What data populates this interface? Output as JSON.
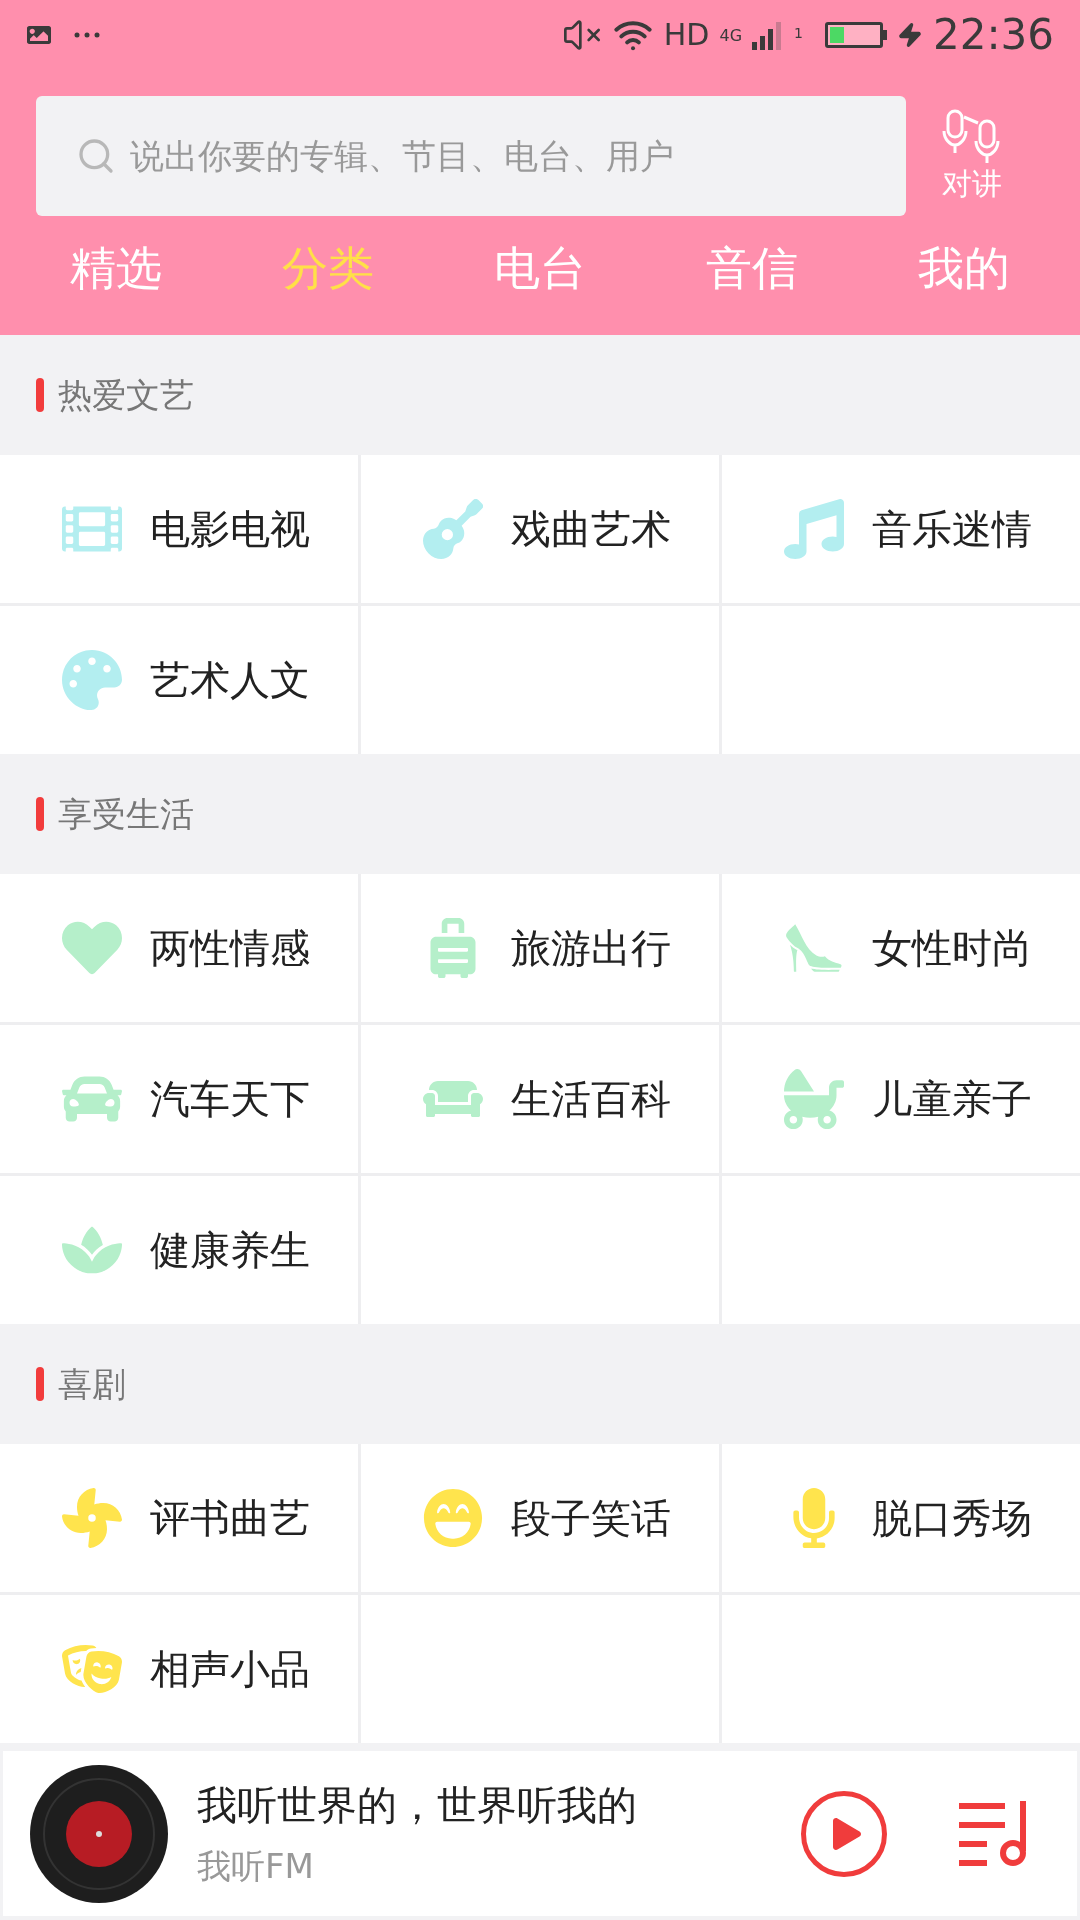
{
  "status_bar": {
    "network": "HD",
    "network_type": "4G",
    "sim": "1",
    "time": "22:36"
  },
  "search": {
    "placeholder": "说出你要的专辑、节目、电台、用户"
  },
  "talk_button": {
    "label": "对讲"
  },
  "tabs": [
    {
      "label": "精选",
      "selected": false
    },
    {
      "label": "分类",
      "selected": true
    },
    {
      "label": "电台",
      "selected": false
    },
    {
      "label": "音信",
      "selected": false
    },
    {
      "label": "我的",
      "selected": false
    }
  ],
  "sections": [
    {
      "title": "热爱文艺",
      "color": "#b3eef0",
      "items": [
        "电影电视",
        "戏曲艺术",
        "音乐迷情",
        "艺术人文"
      ]
    },
    {
      "title": "享受生活",
      "color": "#b5efca",
      "items": [
        "两性情感",
        "旅游出行",
        "女性时尚",
        "汽车天下",
        "生活百科",
        "儿童亲子",
        "健康养生"
      ]
    },
    {
      "title": "喜剧",
      "color": "#ffe44d",
      "items": [
        "评书曲艺",
        "段子笑话",
        "脱口秀场",
        "相声小品"
      ]
    }
  ],
  "player": {
    "title": "我听世界的，世界听我的",
    "subtitle": "我听FM",
    "playing": false
  }
}
